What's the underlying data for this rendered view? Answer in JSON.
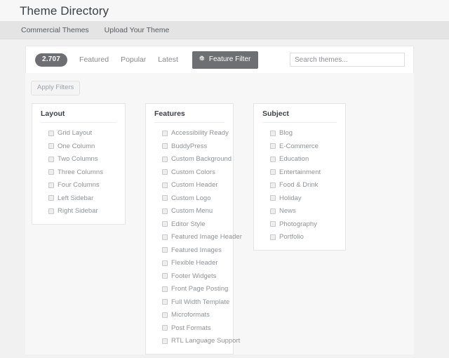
{
  "header": {
    "site_title": "Theme Directory",
    "nav": [
      {
        "label": "Commercial Themes"
      },
      {
        "label": "Upload Your Theme"
      }
    ]
  },
  "toolbar": {
    "count_badge": "2.707",
    "links": [
      {
        "label": "Featured"
      },
      {
        "label": "Popular"
      },
      {
        "label": "Latest"
      }
    ],
    "feature_filter_label": "Feature Filter",
    "feature_filter_icon": "gear-icon",
    "search": {
      "placeholder": "Search themes...",
      "value": ""
    }
  },
  "filters": {
    "apply_label": "Apply Filters",
    "groups": [
      {
        "title": "Layout",
        "options": [
          {
            "label": "Grid Layout",
            "checked": false
          },
          {
            "label": "One Column",
            "checked": false
          },
          {
            "label": "Two Columns",
            "checked": false
          },
          {
            "label": "Three Columns",
            "checked": false
          },
          {
            "label": "Four Columns",
            "checked": false
          },
          {
            "label": "Left Sidebar",
            "checked": false
          },
          {
            "label": "Right Sidebar",
            "checked": false
          }
        ]
      },
      {
        "title": "Features",
        "options": [
          {
            "label": "Accessibility Ready",
            "checked": false
          },
          {
            "label": "BuddyPress",
            "checked": false
          },
          {
            "label": "Custom Background",
            "checked": false
          },
          {
            "label": "Custom Colors",
            "checked": false
          },
          {
            "label": "Custom Header",
            "checked": false
          },
          {
            "label": "Custom Logo",
            "checked": false
          },
          {
            "label": "Custom Menu",
            "checked": false
          },
          {
            "label": "Editor Style",
            "checked": false
          },
          {
            "label": "Featured Image Header",
            "checked": false
          },
          {
            "label": "Featured Images",
            "checked": false
          },
          {
            "label": "Flexible Header",
            "checked": false
          },
          {
            "label": "Footer Widgets",
            "checked": false
          },
          {
            "label": "Front Page Posting",
            "checked": false
          },
          {
            "label": "Full Width Template",
            "checked": false
          },
          {
            "label": "Microformats",
            "checked": false
          },
          {
            "label": "Post Formats",
            "checked": false
          },
          {
            "label": "RTL Language Support",
            "checked": false
          }
        ]
      },
      {
        "title": "Subject",
        "options": [
          {
            "label": "Blog",
            "checked": false
          },
          {
            "label": "E-Commerce",
            "checked": false
          },
          {
            "label": "Education",
            "checked": false
          },
          {
            "label": "Entertainment",
            "checked": false
          },
          {
            "label": "Food & Drink",
            "checked": false
          },
          {
            "label": "Holiday",
            "checked": false
          },
          {
            "label": "News",
            "checked": false
          },
          {
            "label": "Photography",
            "checked": false
          },
          {
            "label": "Portfolio",
            "checked": false
          }
        ]
      }
    ]
  }
}
